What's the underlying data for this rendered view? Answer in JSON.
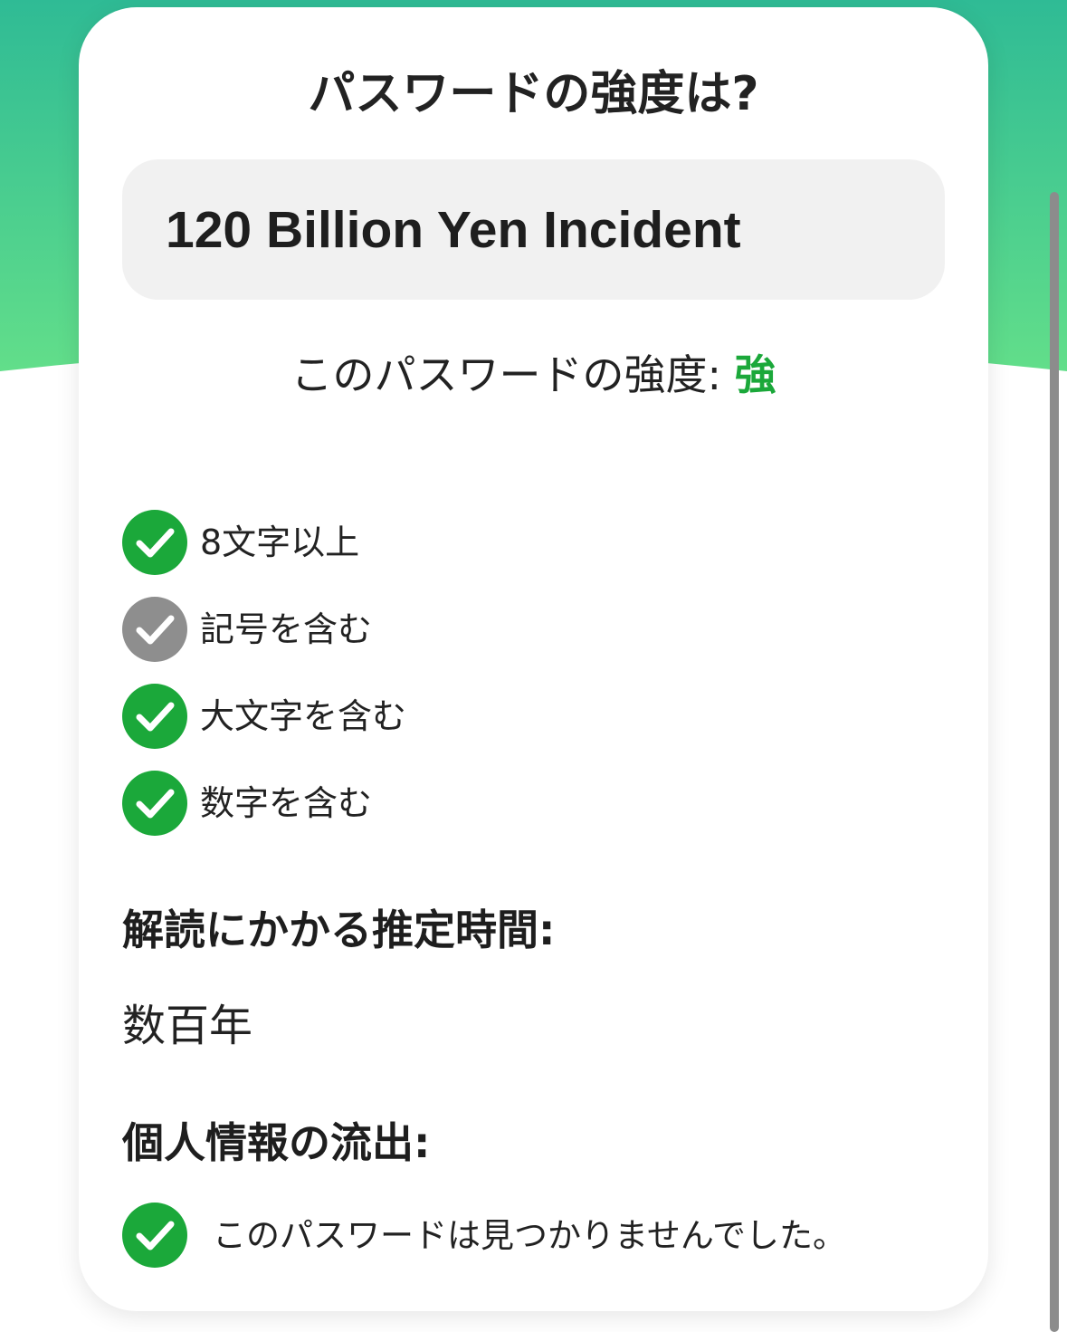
{
  "header": {
    "title": "パスワードの強度は?"
  },
  "password": {
    "value": "120 Billion Yen Incident"
  },
  "strength": {
    "label": "このパスワードの強度: ",
    "value": "強",
    "value_color": "#1ba83a"
  },
  "criteria": [
    {
      "label": "8文字以上",
      "status": "met",
      "icon": "check-circle-icon",
      "color": "#1ba83a"
    },
    {
      "label": "記号を含む",
      "status": "unmet",
      "icon": "check-circle-icon",
      "color": "#8e8e8e"
    },
    {
      "label": "大文字を含む",
      "status": "met",
      "icon": "check-circle-icon",
      "color": "#1ba83a"
    },
    {
      "label": "数字を含む",
      "status": "met",
      "icon": "check-circle-icon",
      "color": "#1ba83a"
    }
  ],
  "crack_time": {
    "heading": "解読にかかる推定時間:",
    "value": "数百年"
  },
  "breach": {
    "heading": "個人情報の流出:",
    "message": "このパスワードは見つかりませんでした。",
    "icon": "check-circle-icon",
    "color": "#1ba83a"
  },
  "theme": {
    "gradient_top": "#2fbb95",
    "gradient_bottom": "#62de8a"
  }
}
